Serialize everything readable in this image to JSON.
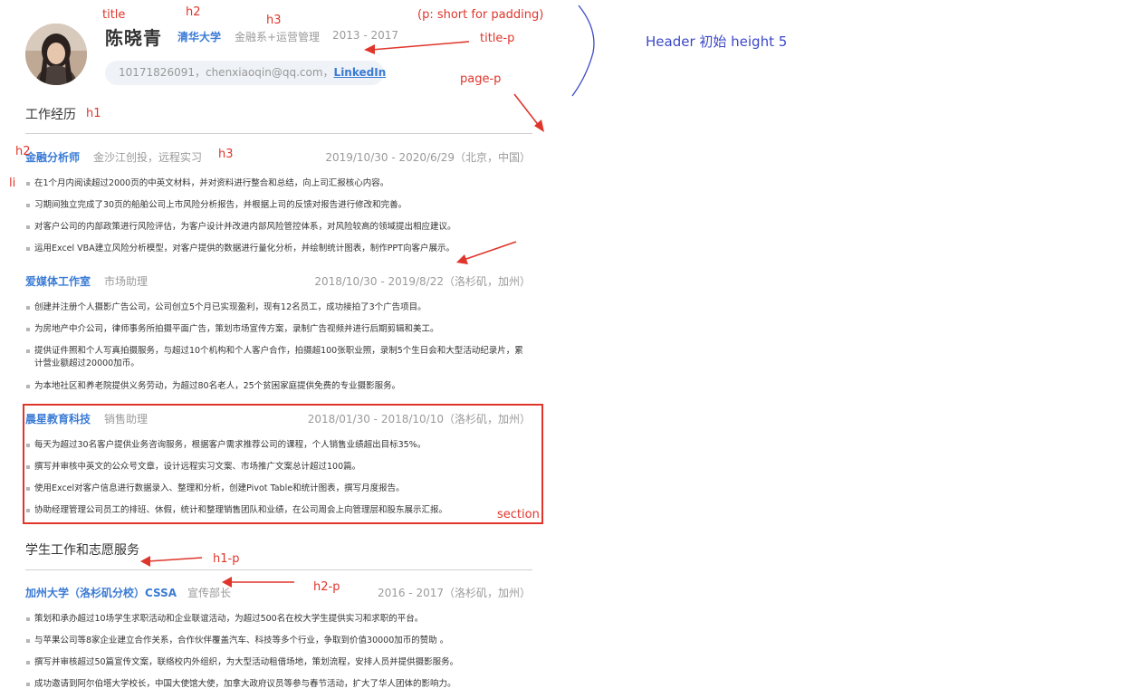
{
  "header": {
    "name": "陈晓青",
    "school": "清华大学",
    "major": "金融系+运营管理",
    "years": "2013 - 2017",
    "contact_text": "10171826091，chenxiaoqin@qq.com，",
    "linkedin": "LinkedIn"
  },
  "sections": [
    {
      "title": "工作经历",
      "jobs": [
        {
          "org": "金融分析师",
          "role": "金沙江创投，远程实习",
          "date": "2019/10/30 - 2020/6/29（北京，中国）",
          "items": [
            "在1个月内阅读超过2000页的中英文材料，并对资料进行整合和总结，向上司汇报核心内容。",
            "习期间独立完成了30页的船舶公司上市风险分析报告，并根据上司的反馈对报告进行修改和完善。",
            "对客户公司的内部政策进行风险评估，为客户设计并改进内部风险管控体系，对风险较高的领域提出相应建议。",
            "运用Excel VBA建立风险分析模型，对客户提供的数据进行量化分析，并绘制统计图表，制作PPT向客户展示。"
          ]
        },
        {
          "org": "爱媒体工作室",
          "role": "市场助理",
          "date": "2018/10/30 - 2019/8/22（洛杉矶，加州）",
          "items": [
            "创建并注册个人摄影广告公司，公司创立5个月已实现盈利，现有12名员工，成功接拍了3个广告项目。",
            "为房地产中介公司，律师事务所拍摄平面广告，策划市场宣传方案，录制广告视频并进行后期剪辑和美工。",
            "提供证件照和个人写真拍摄服务，与超过10个机构和个人客户合作，拍摄超100张职业照，录制5个生日会和大型活动纪录片，累计营业额超过20000加币。",
            "为本地社区和养老院提供义务劳动，为超过80名老人，25个贫困家庭提供免费的专业摄影服务。"
          ]
        },
        {
          "org": "晨星教育科技",
          "role": "销售助理",
          "date": "2018/01/30 - 2018/10/10（洛杉矶，加州）",
          "items": [
            "每天为超过30名客户提供业务咨询服务，根据客户需求推荐公司的课程，个人销售业绩超出目标35%。",
            "撰写并审核中英文的公众号文章，设计远程实习文案、市场推广文案总计超过100篇。",
            "使用Excel对客户信息进行数据录入、整理和分析，创建Pivot Table和统计图表，撰写月度报告。",
            "协助经理管理公司员工的排班、休假，统计和整理销售团队和业绩，在公司周会上向管理层和股东展示汇报。"
          ]
        }
      ]
    },
    {
      "title": "学生工作和志愿服务",
      "jobs": [
        {
          "org": "加州大学（洛杉矶分校）CSSA",
          "role": "宣传部长",
          "date": "2016 - 2017（洛杉矶，加州）",
          "items": [
            "策划和承办超过10场学生求职活动和企业联谊活动，为超过500名在校大学生提供实习和求职的平台。",
            "与苹果公司等8家企业建立合作关系，合作伙伴覆盖汽车、科技等多个行业，争取到价值30000加币的赞助 。",
            "撰写并审核超过50篇宣传文案，联络校内外组织，为大型活动租借场地，策划流程，安排人员并提供摄影服务。",
            "成功邀请到阿尔伯塔大学校长，中国大使馆大使，加拿大政府议员等参与春节活动，扩大了华人团体的影响力。"
          ]
        }
      ]
    }
  ],
  "annotations": {
    "title": "title",
    "h2": "h2",
    "h3": "h3",
    "p_note": "(p: short for padding)",
    "title_p": "title-p",
    "page_p": "page-p",
    "header_note": "Header 初始 height 5",
    "h1": "h1",
    "h2_left": "h2",
    "h3_job": "h3",
    "li": "li",
    "section": "section",
    "h1_p": "h1-p",
    "h2_p": "h2-p"
  },
  "colors": {
    "accent": "#3a7bd5",
    "muted": "#9a9a9a",
    "annotation_red": "#e0352b",
    "annotation_blue": "#3b48c8"
  }
}
